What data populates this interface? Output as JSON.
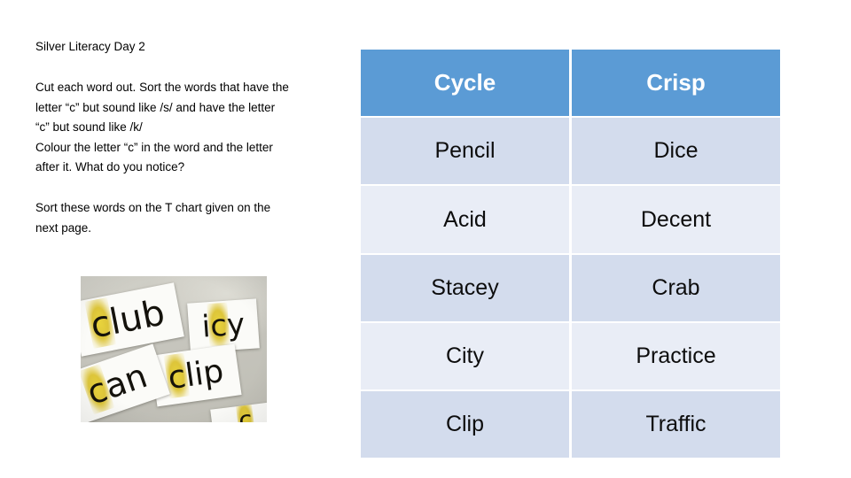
{
  "slide": {
    "title": "Silver Literacy Day 2",
    "instructions": [
      "Cut each word out. Sort the words that have the",
      "letter “c” but sound like /s/ and have the letter",
      "“c” but sound like /k/",
      "Colour the letter “c” in the word and the letter",
      "after it. What do you notice?"
    ],
    "sort_note": [
      "Sort these words on the T chart given on the",
      "next page."
    ]
  },
  "photo": {
    "caption": "photograph of cut-out word cards on a desk",
    "cards": [
      {
        "word": "club",
        "highlight": "c",
        "rest": "lub"
      },
      {
        "word": "icy",
        "highlight": "c",
        "pre": "i",
        "rest": "y"
      },
      {
        "word": "clip",
        "highlight": "c",
        "rest": "lip"
      },
      {
        "word": "can",
        "highlight": "c",
        "rest": "an"
      },
      {
        "word": "c",
        "highlight": "c",
        "rest": ""
      }
    ]
  },
  "table": {
    "headers": [
      "Cycle",
      "Crisp"
    ],
    "rows": [
      [
        "Pencil",
        "Dice"
      ],
      [
        "Acid",
        "Decent"
      ],
      [
        "Stacey",
        "Crab"
      ],
      [
        "City",
        "Practice"
      ],
      [
        "Clip",
        "Traffic"
      ]
    ]
  },
  "colors": {
    "header_blue": "#5B9BD5",
    "band_dark": "#D3DCED",
    "band_light": "#E9EDF6",
    "header_text": "#FFFFFF",
    "body_text": "#0D0D0D",
    "page_background": "#FFFFFF"
  }
}
